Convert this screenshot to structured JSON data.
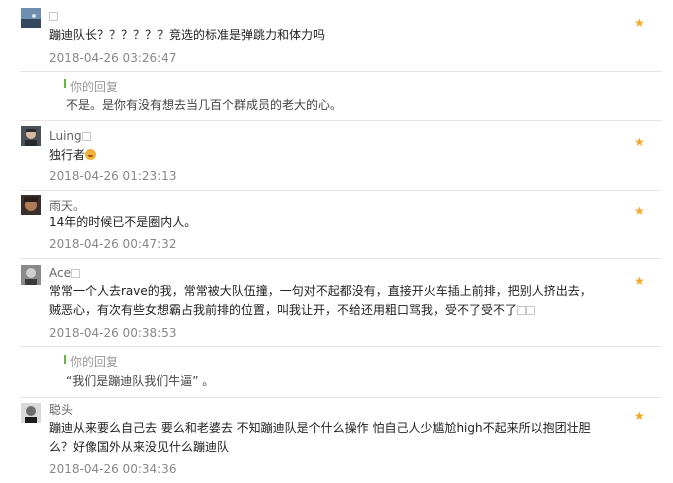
{
  "comments": [
    {
      "author": "",
      "body": "蹦迪队长？？？？？？竞选的标准是弹跳力和体力吗",
      "time": "2018-04-26 03:26:47",
      "avatar": "avatar-sky",
      "star_icon": "star-icon",
      "reply": {
        "label": "你的回复",
        "text": "不是。是你有没有想去当几百个群成员的老大的心。"
      }
    },
    {
      "author": "Luing",
      "body": "独行者",
      "time": "2018-04-26 01:23:13",
      "avatar": "avatar-person-dark",
      "star_icon": "star-icon"
    },
    {
      "author": "雨天。",
      "body": "14年的时候已不是圈内人。",
      "time": "2018-04-26 00:47:32",
      "avatar": "avatar-face-warm",
      "star_icon": "star-icon"
    },
    {
      "author": "Ace",
      "body": "常常一个人去rave的我，常常被大队伍撞，一句对不起都没有，直接开火车插上前排，把别人挤出去，贼恶心，有次有些女想霸占我前排的位置，叫我让开，不给还用粗口骂我，受不了受不了",
      "time": "2018-04-26 00:38:53",
      "avatar": "avatar-person-gray",
      "star_icon": "star-icon",
      "reply": {
        "label": "你的回复",
        "text": "“我们是蹦迪队我们牛逼” 。"
      }
    },
    {
      "author": "聪头",
      "body": "蹦迪从来要么自己去 要么和老婆去 不知蹦迪队是个什么操作 怕自己人少尴尬high不起来所以抱团壮胆么？好像国外从来没见什么蹦迪队",
      "time": "2018-04-26 00:34:36",
      "avatar": "avatar-person-bw",
      "star_icon": "star-icon"
    }
  ],
  "colors": {
    "star": "#f5a623",
    "reply_bar": "#6ab04c",
    "timestamp": "#888888",
    "divider": "#e6e6e6"
  }
}
